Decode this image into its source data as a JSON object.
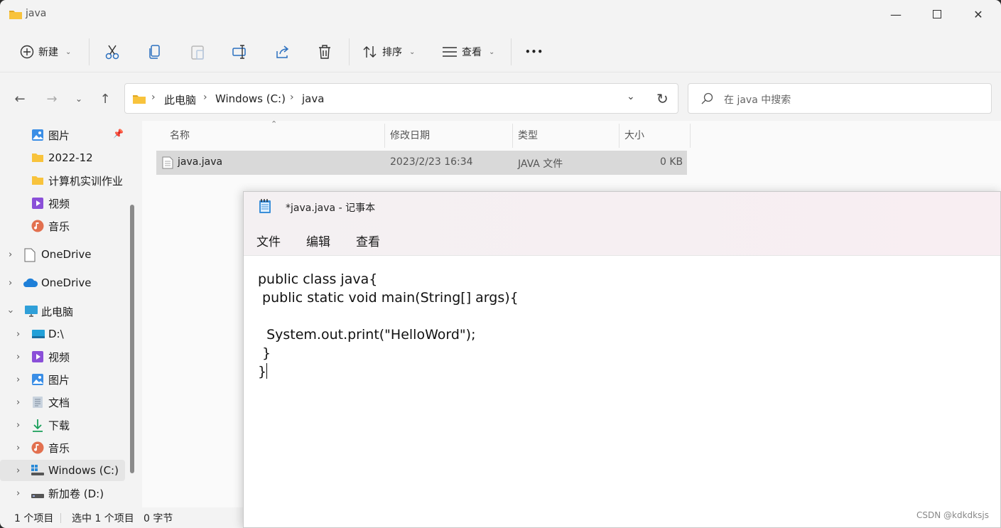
{
  "explorer": {
    "title": "java",
    "toolbar": {
      "new_label": "新建",
      "sort_label": "排序",
      "view_label": "查看",
      "more_label": "•••"
    },
    "breadcrumb": [
      "此电脑",
      "Windows (C:)",
      "java"
    ],
    "search_placeholder": "在 java 中搜索",
    "nav": {
      "quick": [
        {
          "label": "图片",
          "icon": "pictures-icon",
          "pinned": true
        },
        {
          "label": "2022-12",
          "icon": "folder-icon"
        },
        {
          "label": "计算机实训作业",
          "icon": "folder-icon"
        },
        {
          "label": "视频",
          "icon": "videos-icon"
        },
        {
          "label": "音乐",
          "icon": "music-icon"
        }
      ],
      "onedrive_1": "OneDrive",
      "onedrive_2": "OneDrive",
      "this_pc": "此电脑",
      "pc_items": [
        {
          "label": "D:\\",
          "icon": "drive-icon"
        },
        {
          "label": "视频",
          "icon": "videos-icon"
        },
        {
          "label": "图片",
          "icon": "pictures-icon"
        },
        {
          "label": "文档",
          "icon": "documents-icon"
        },
        {
          "label": "下载",
          "icon": "downloads-icon"
        },
        {
          "label": "音乐",
          "icon": "music-icon"
        },
        {
          "label": "Windows (C:)",
          "icon": "windows-drive-icon",
          "selected": true
        },
        {
          "label": "新加卷 (D:)",
          "icon": "drive-icon"
        }
      ]
    },
    "columns": {
      "name": "名称",
      "modified": "修改日期",
      "type": "类型",
      "size": "大小"
    },
    "files": [
      {
        "name": "java.java",
        "modified": "2023/2/23 16:34",
        "type": "JAVA 文件",
        "size": "0 KB"
      }
    ],
    "status": {
      "count": "1 个项目",
      "selected": "选中 1 个项目",
      "bytes": "0 字节"
    }
  },
  "notepad": {
    "title": "*java.java - 记事本",
    "menu": [
      "文件",
      "编辑",
      "查看"
    ],
    "content": [
      "public class java{",
      " public static void main(String[] args){",
      "",
      "  System.out.print(\"HelloWord\");",
      " }",
      "}"
    ]
  },
  "watermark": "CSDN @kdkdksjs",
  "colors": {
    "selection": "#d9d9d9",
    "accent": "#0067c0",
    "folder": "#f8c33c"
  }
}
